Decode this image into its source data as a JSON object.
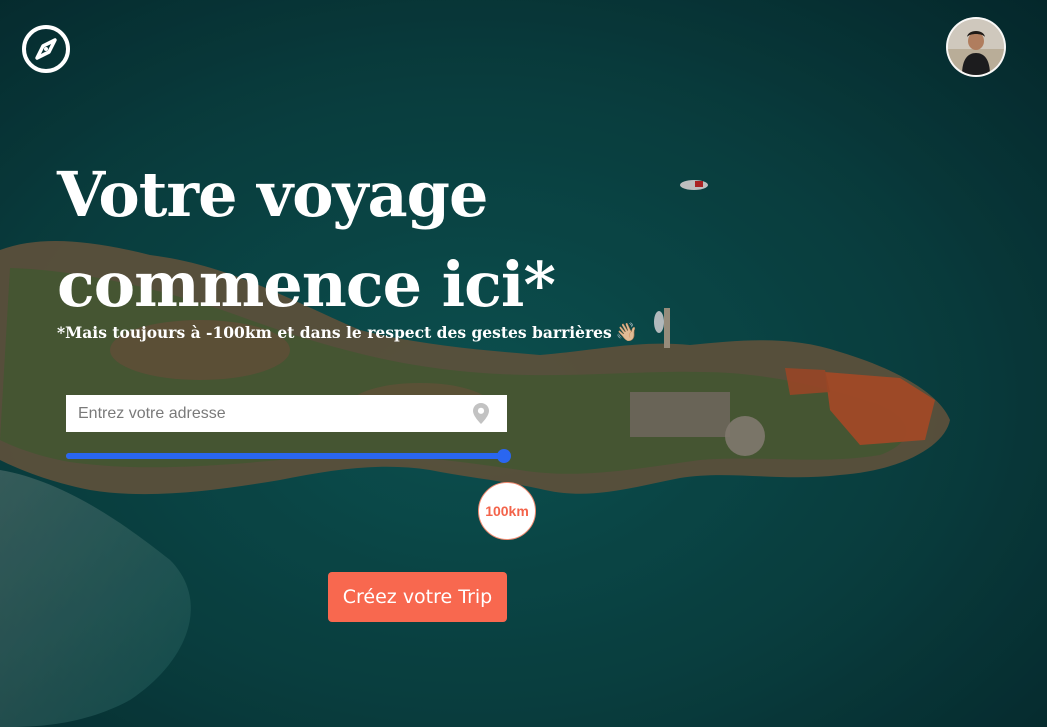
{
  "header": {
    "logo_icon": "compass-icon",
    "avatar_icon": "user-avatar"
  },
  "hero": {
    "title": "Votre voyage\ncommence ici*",
    "subtitle": "*Mais toujours à -100km et dans le respect des gestes barrières",
    "subtitle_emoji": "👋🏼"
  },
  "search": {
    "placeholder": "Entrez votre adresse",
    "value": "",
    "icon": "map-pin-icon"
  },
  "radius": {
    "value_km": 100,
    "max_km": 100,
    "label": "100km"
  },
  "cta": {
    "label": "Créez votre Trip"
  },
  "colors": {
    "accent": "#f8684f",
    "slider": "#2a66f0",
    "background": "#0b4648"
  }
}
